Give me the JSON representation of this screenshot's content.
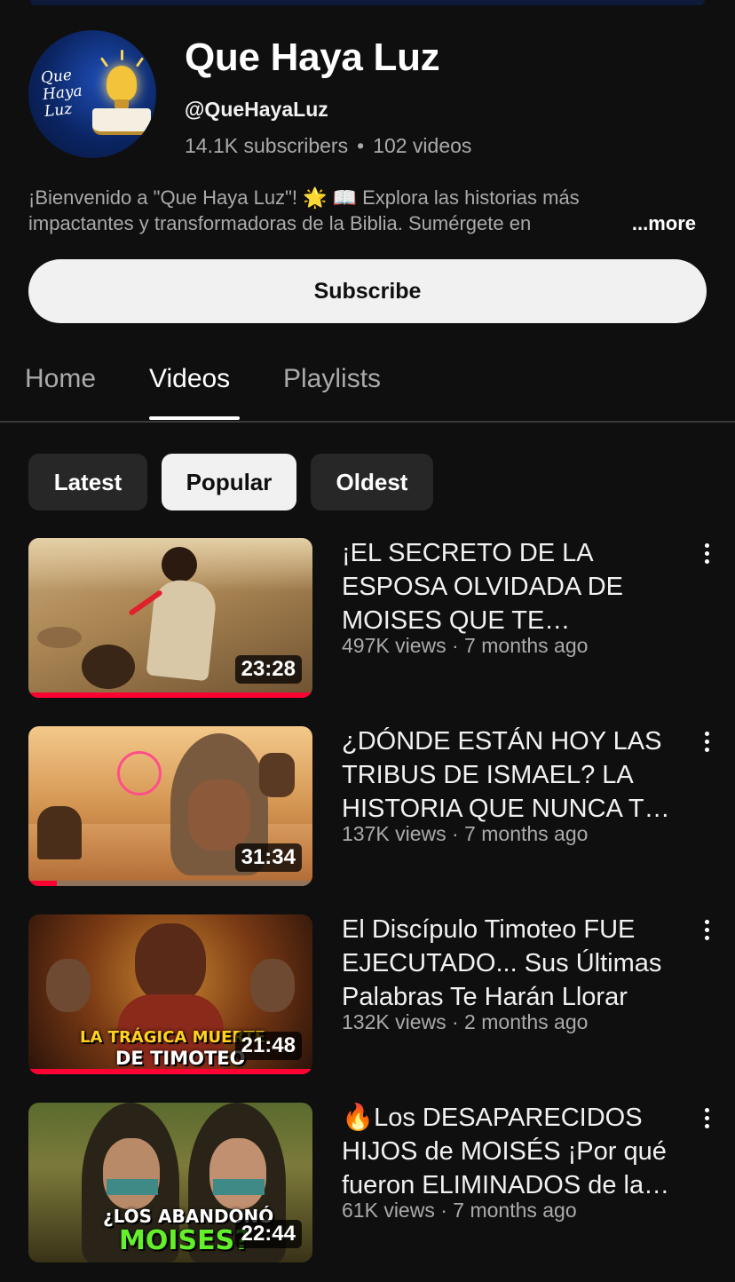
{
  "channel": {
    "name": "Que Haya Luz",
    "handle": "@QueHayaLuz",
    "subscribers": "14.1K subscribers",
    "separator": "•",
    "videos": "102 videos",
    "logo_text": "Que Haya Luz",
    "description_line1": "¡Bienvenido a \"Que Haya Luz\"! 🌟 📖 Explora las historias más",
    "description_line2": "impactantes y transformadoras de la Biblia. Sumérgete en",
    "more_label": "...more"
  },
  "subscribe_label": "Subscribe",
  "tabs": [
    {
      "label": "Home",
      "active": false
    },
    {
      "label": "Videos",
      "active": true
    },
    {
      "label": "Playlists",
      "active": false
    }
  ],
  "chips": [
    {
      "label": "Latest",
      "selected": false
    },
    {
      "label": "Popular",
      "selected": true
    },
    {
      "label": "Oldest",
      "selected": false
    }
  ],
  "videos": [
    {
      "title": "¡EL SECRETO DE LA ESPOSA OLVIDADA DE MOISES QUE TE SORPRENDERÁ!",
      "meta": "497K views · 7 months ago",
      "duration": "23:28",
      "watched_fraction": 1.0,
      "thumb_overlay_line1": "",
      "thumb_overlay_line2": ""
    },
    {
      "title": "¿DÓNDE ESTÁN HOY LAS TRIBUS DE ISMAEL? LA HISTORIA QUE NUNCA TE CONTARON",
      "meta": "137K views · 7 months ago",
      "duration": "31:34",
      "watched_fraction": 0.1,
      "thumb_overlay_line1": "",
      "thumb_overlay_line2": ""
    },
    {
      "title": "El Discípulo Timoteo FUE EJECUTADO... Sus Últimas Palabras Te Harán Llorar",
      "meta": "132K views · 2 months ago",
      "duration": "21:48",
      "watched_fraction": 1.0,
      "thumb_overlay_line1": "LA TRÁGICA MUERTE",
      "thumb_overlay_line2": "DE TIMOTEO"
    },
    {
      "title": "🔥Los DESAPARECIDOS HIJOS de MOISÉS ¡Por qué fueron ELIMINADOS de la historia?",
      "meta": "61K views · 7 months ago",
      "duration": "22:44",
      "watched_fraction": 0,
      "thumb_overlay_line1": "¿LOS ABANDONÓ",
      "thumb_overlay_line2": "MOISES?"
    }
  ]
}
